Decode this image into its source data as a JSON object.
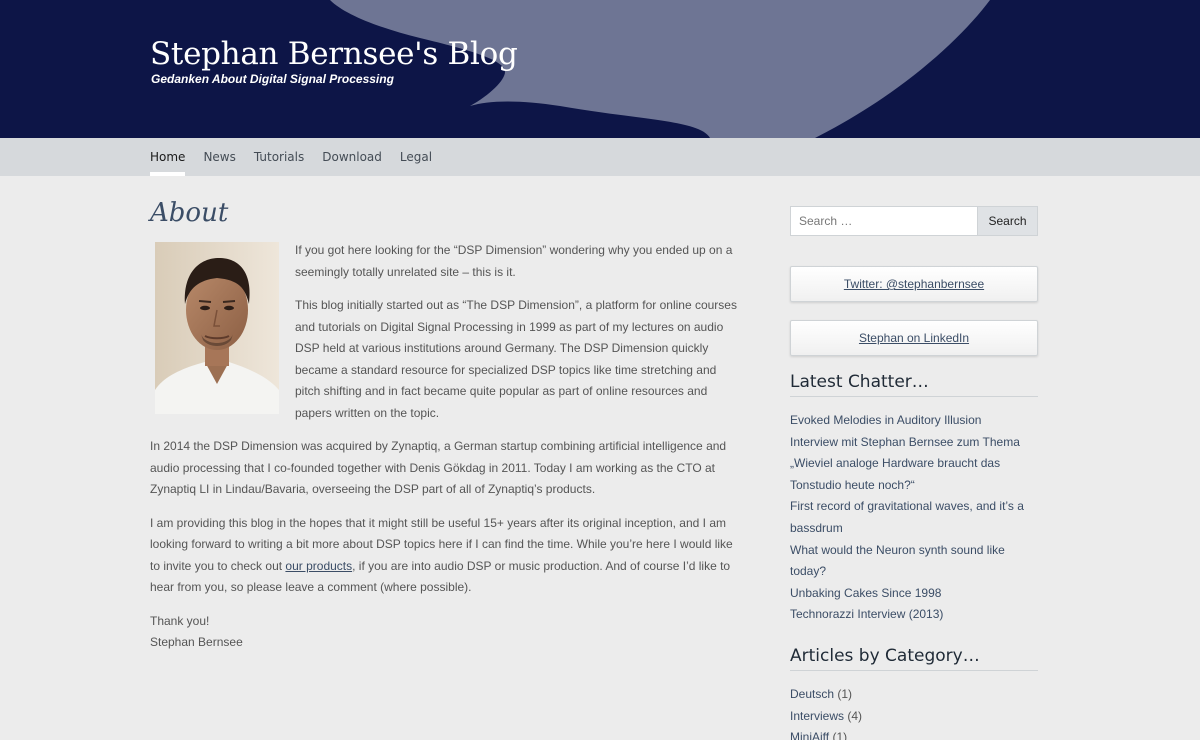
{
  "header": {
    "site_title": "Stephan Bernsee's Blog",
    "tagline": "Gedanken About Digital Signal Processing",
    "background_color": "#0d1547"
  },
  "nav": {
    "items": [
      {
        "label": "Home",
        "active": true
      },
      {
        "label": "News"
      },
      {
        "label": "Tutorials"
      },
      {
        "label": "Download"
      },
      {
        "label": "Legal"
      }
    ]
  },
  "page": {
    "title": "About",
    "p1": "If you got here looking for the “DSP Dimension” wondering why you ended up on a seemingly totally unrelated site – this is it.",
    "p2": "This blog initially started out as “The DSP Dimension”, a platform for online courses and tutorials on Digital Signal Processing in 1999 as part of my lectures on audio DSP held at various institutions around Germany. The DSP Dimension quickly became a standard resource for specialized DSP topics like time stretching and pitch shifting and in fact became quite popular as part of online resources and papers written on the topic.",
    "p3": "In 2014 the DSP Dimension was acquired by Zynaptiq, a German startup combining artificial intelligence and audio processing that I co-founded together with Denis Gökdag in 2011. Today I am working as the CTO at Zynaptiq LI in Lindau/Bavaria, overseeing the DSP part of all of Zynaptiq’s products.",
    "p4_before": "I am providing this blog in the hopes that it might still be useful 15+ years after its original inception, and I am looking forward to writing a bit more about DSP topics here if I can find the time. While you’re here I would like to invite you to check out ",
    "p4_link": "our products",
    "p4_after": ", if you are into audio DSP or music production. And of course I’d like to hear from you, so please leave a comment (where possible).",
    "thanks": "Thank you!",
    "signature": "Stephan Bernsee"
  },
  "sidebar": {
    "search": {
      "placeholder": "Search …",
      "button_label": "Search"
    },
    "twitter_label": "Twitter: @stephanbernsee",
    "linkedin_label": "Stephan on LinkedIn",
    "latest_title": "Latest Chatter…",
    "latest_posts": [
      "Evoked Melodies in Auditory Illusion",
      "Interview mit Stephan Bernsee zum Thema „Wieviel analoge Hardware braucht das Tonstudio heute noch?“",
      "First record of gravitational waves, and it’s a bassdrum",
      "What would the Neuron synth sound like today?",
      "Unbaking Cakes Since 1998",
      "Technorazzi Interview (2013)"
    ],
    "categories_title": "Articles by Category…",
    "categories": [
      {
        "name": "Deutsch",
        "count": "(1)"
      },
      {
        "name": "Interviews",
        "count": "(4)"
      },
      {
        "name": "MiniAiff",
        "count": "(1)"
      }
    ]
  }
}
